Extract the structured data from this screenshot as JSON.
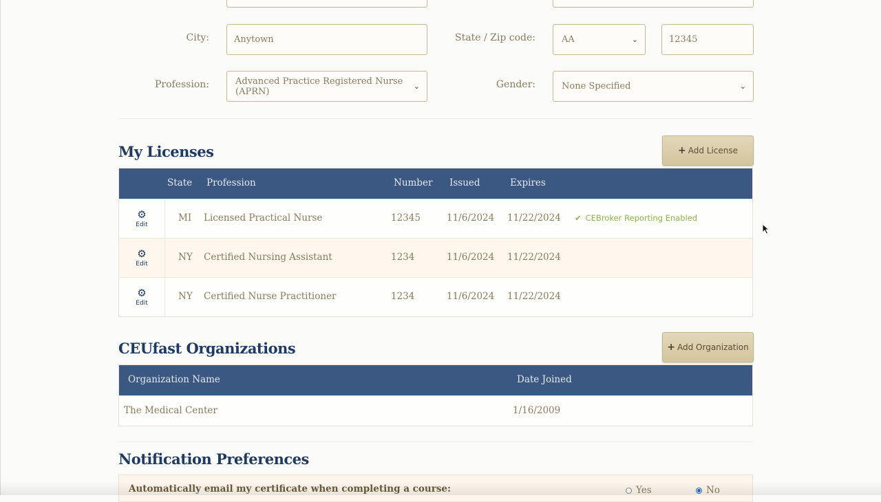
{
  "profile_form": {
    "city_label": "City:",
    "city_value": "Anytown",
    "state_zip_label": "State / Zip code:",
    "state_value": "AA",
    "zip_value": "12345",
    "profession_label": "Profession:",
    "profession_value": "Advanced Practice Registered Nurse (APRN)",
    "gender_label": "Gender:",
    "gender_value": "None Specified"
  },
  "licenses": {
    "title": "My Licenses",
    "add_button": "Add License",
    "columns": {
      "state": "State",
      "profession": "Profession",
      "number": "Number",
      "issued": "Issued",
      "expires": "Expires"
    },
    "edit_label": "Edit",
    "rows": [
      {
        "state": "MI",
        "profession": "Licensed Practical Nurse",
        "number": "12345",
        "issued": "11/6/2024",
        "expires": "11/22/2024",
        "status": "CEBroker Reporting Enabled"
      },
      {
        "state": "NY",
        "profession": "Certified Nursing Assistant",
        "number": "1234",
        "issued": "11/6/2024",
        "expires": "11/22/2024",
        "status": ""
      },
      {
        "state": "NY",
        "profession": "Certified Nurse Practitioner",
        "number": "1234",
        "issued": "11/6/2024",
        "expires": "11/22/2024",
        "status": ""
      }
    ]
  },
  "organizations": {
    "title": "CEUfast Organizations",
    "add_button": "Add Organization",
    "columns": {
      "name": "Organization Name",
      "date": "Date Joined"
    },
    "rows": [
      {
        "name": "The Medical Center",
        "date": "1/16/2009"
      }
    ]
  },
  "notifications": {
    "title": "Notification Preferences",
    "question": "Automatically email my certificate when completing a course:",
    "yes_label": "Yes",
    "no_label": "No",
    "selected": "No"
  },
  "icons": {
    "edit": "gear-icon",
    "add": "plus-icon",
    "status": "check-icon",
    "select": "chevron-down-icon",
    "pointer": "mouse-cursor"
  }
}
